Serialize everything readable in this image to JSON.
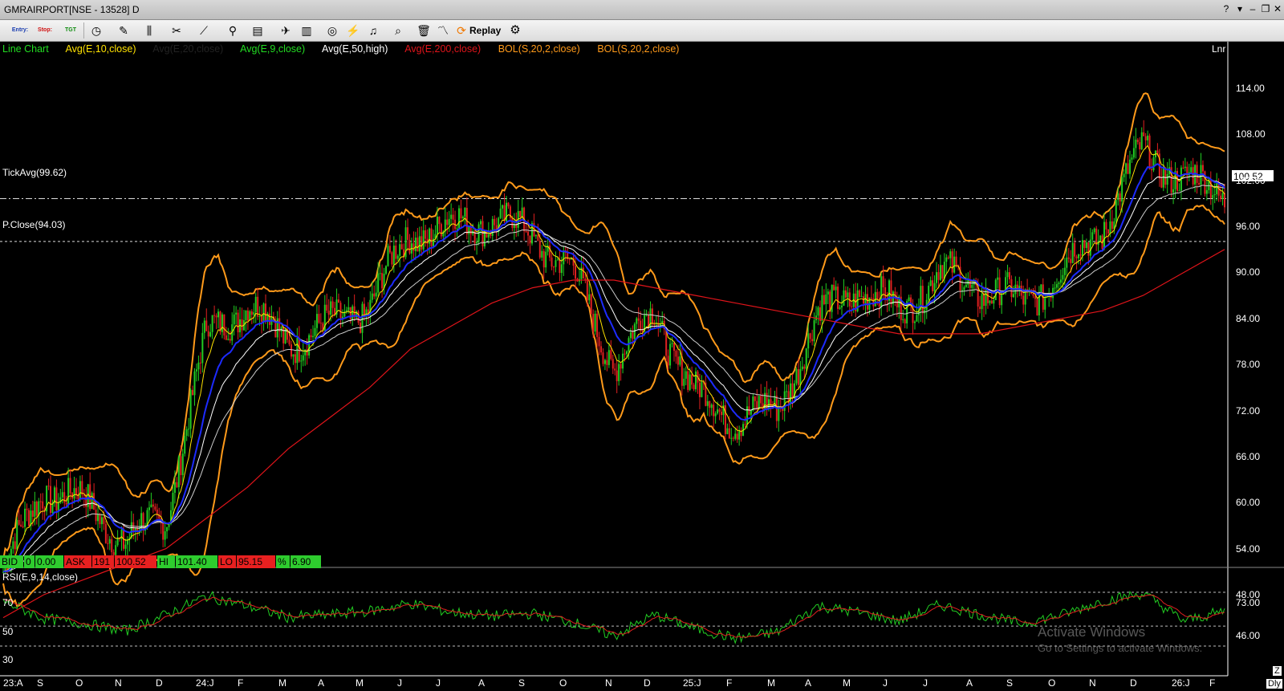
{
  "window": {
    "title": "GMRAIRPORT[NSE - 13528] D"
  },
  "toolbar": {
    "entry_label": "Entry:",
    "stop_label": "Stop:",
    "tgt_label": "TGT",
    "replay_label": "Replay"
  },
  "indicators": {
    "line_chart": "Line Chart",
    "avg1": "Avg(E,10,close)",
    "avg2": "Avg(E,20,close)",
    "avg3": "Avg(E,9,close)",
    "avg4": "Avg(E,50,high)",
    "avg5": "Avg(E,200,close)",
    "bol1": "BOL(S,20,2,close)",
    "bol2": "BOL(S,20,2,close)",
    "scale": "Lnr"
  },
  "lines": {
    "tick_avg": "TickAvg(99.62)",
    "prev_close": "P.Close(94.03)",
    "last_price": "100.52"
  },
  "price_axis": [
    "114.00",
    "108.00",
    "102.00",
    "96.00",
    "90.00",
    "84.00",
    "78.00",
    "72.00",
    "66.00",
    "60.00",
    "54.00",
    "48.00"
  ],
  "quote": {
    "bid_label": "BID",
    "bid_qty": "0",
    "bid_price": "0.00",
    "ask_label": "ASK",
    "ask_qty": "191",
    "ask_price": "100.52",
    "hi_label": "HI",
    "hi": "101.40",
    "lo_label": "LO",
    "lo": "95.15",
    "pct_label": "%",
    "pct": "6.90"
  },
  "rsi": {
    "label": "RSI(E,9,14,close)",
    "left_levels": [
      "70",
      "50",
      "30"
    ],
    "right_levels": [
      "73.00",
      "46.00"
    ]
  },
  "time_axis": [
    "23:A",
    "S",
    "O",
    "N",
    "D",
    "24:J",
    "F",
    "M",
    "A",
    "M",
    "J",
    "J",
    "A",
    "S",
    "O",
    "N",
    "D",
    "25:J",
    "F",
    "M",
    "A",
    "M",
    "J",
    "J",
    "A",
    "S",
    "O",
    "N",
    "D",
    "26:J",
    "F"
  ],
  "corner": {
    "z": "Z",
    "dly": "Dly"
  },
  "watermark": {
    "line1": "Activate Windows",
    "line2": "Go to Settings to activate Windows."
  },
  "colors": {
    "bollinger": "#ff9a1a",
    "ema_blue": "#1d2bff",
    "sma200": "#e0141a",
    "up": "#22cc22",
    "down": "#e02020",
    "rsi": "#22cc22",
    "rsi_signal": "#e02020"
  },
  "chart_data": {
    "type": "line",
    "title": "GMRAIRPORT[NSE - 13528] D",
    "ylim": [
      44,
      118
    ],
    "x": [
      "23:A",
      "S",
      "O",
      "N",
      "D",
      "24:J",
      "F",
      "M",
      "A",
      "M",
      "J",
      "J",
      "A",
      "S",
      "O",
      "N",
      "D",
      "25:J",
      "F",
      "M",
      "A",
      "M",
      "J",
      "J",
      "A",
      "S",
      "O",
      "N",
      "D",
      "26:J",
      "F"
    ],
    "series": [
      {
        "name": "close",
        "values": [
          51,
          62,
          60,
          55,
          58,
          82,
          86,
          81,
          83,
          86,
          95,
          96,
          97,
          95,
          90,
          78,
          85,
          74,
          71,
          72,
          84,
          88,
          85,
          90,
          88,
          86,
          90,
          96,
          106,
          102,
          100.52
        ]
      },
      {
        "name": "Avg(E,200,close)",
        "values": [
          45,
          48,
          50,
          52,
          54,
          58,
          62,
          67,
          71,
          75,
          80,
          83,
          86,
          88,
          89,
          89,
          88,
          87,
          86,
          85,
          84,
          83,
          82,
          82,
          82,
          83,
          84,
          85,
          87,
          90,
          93
        ]
      }
    ],
    "rsi": {
      "name": "RSI(E,9,14,close)",
      "ylim": [
        20,
        85
      ],
      "values": [
        66,
        52,
        48,
        42,
        55,
        70,
        62,
        53,
        55,
        58,
        64,
        57,
        54,
        56,
        49,
        38,
        55,
        44,
        36,
        41,
        62,
        57,
        50,
        63,
        55,
        48,
        55,
        66,
        72,
        50,
        58
      ]
    }
  }
}
